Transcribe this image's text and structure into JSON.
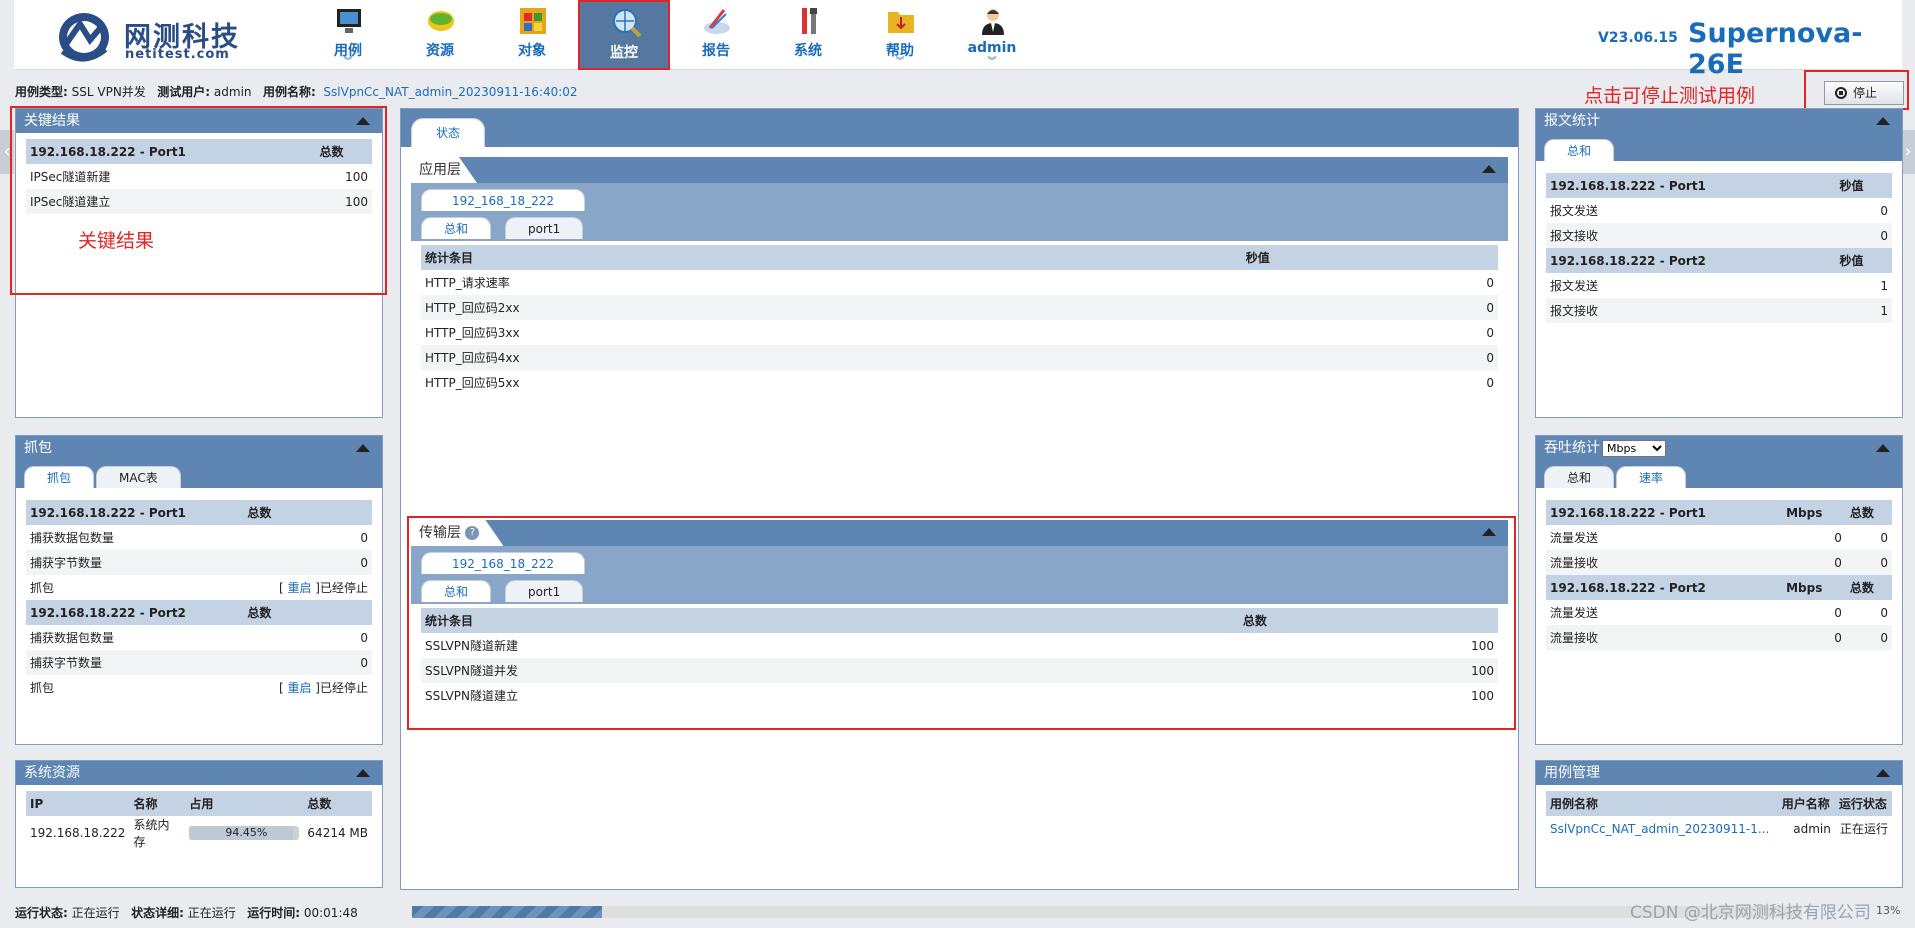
{
  "header": {
    "logo_name": "网测科技",
    "logo_sub": "netitest.com",
    "nav": [
      {
        "label": "用例",
        "caret": true,
        "icon": "monitor-icon"
      },
      {
        "label": "资源",
        "caret": false,
        "icon": "resource-icon"
      },
      {
        "label": "对象",
        "caret": false,
        "icon": "objects-icon"
      },
      {
        "label": "监控",
        "caret": false,
        "icon": "globe-search-icon"
      },
      {
        "label": "报告",
        "caret": false,
        "icon": "report-icon"
      },
      {
        "label": "系统",
        "caret": false,
        "icon": "tools-icon"
      },
      {
        "label": "帮助",
        "caret": true,
        "icon": "folder-icon"
      },
      {
        "label": "admin",
        "caret": true,
        "icon": "user-icon"
      }
    ],
    "version": "V23.06.15",
    "product": "Supernova-26E"
  },
  "info": {
    "type_label": "用例类型:",
    "type_value": "SSL VPN并发",
    "user_label": "测试用户:",
    "user_value": "admin",
    "name_label": "用例名称:",
    "name_value": "SslVpnCc_NAT_admin_20230911-16:40:02"
  },
  "hint": "点击可停止测试用例",
  "stop_label": "停止",
  "key_results": {
    "title": "关键结果",
    "header": [
      "192.168.18.222 - Port1",
      "总数"
    ],
    "rows": [
      [
        "IPSec隧道新建",
        "100"
      ],
      [
        "IPSec隧道建立",
        "100"
      ]
    ],
    "note": "关键结果"
  },
  "capture": {
    "title": "抓包",
    "tabs": [
      "抓包",
      "MAC表"
    ],
    "groups": [
      {
        "header": [
          "192.168.18.222 - Port1",
          "总数"
        ],
        "rows": [
          [
            "捕获数据包数量",
            "0"
          ],
          [
            "捕获字节数量",
            "0"
          ]
        ],
        "capture_label": "抓包",
        "restart": "重启",
        "stopped": "已经停止"
      },
      {
        "header": [
          "192.168.18.222 - Port2",
          "总数"
        ],
        "rows": [
          [
            "捕获数据包数量",
            "0"
          ],
          [
            "捕获字节数量",
            "0"
          ]
        ],
        "capture_label": "抓包",
        "restart": "重启",
        "stopped": "已经停止"
      }
    ]
  },
  "sysres": {
    "title": "系统资源",
    "headers": [
      "IP",
      "名称",
      "占用",
      "总数"
    ],
    "row": {
      "ip": "192.168.18.222",
      "name": "系统内存",
      "bar_label": "94.45%",
      "bar_fraction": 0.9445,
      "total": "64214 MB"
    }
  },
  "center": {
    "status_tab": "状态",
    "app_layer": {
      "title": "应用层",
      "ip_tab": "192_168_18_222",
      "tabs": [
        "总和",
        "port1"
      ],
      "headers": [
        "统计条目",
        "秒值"
      ],
      "rows": [
        [
          "HTTP_请求速率",
          "0"
        ],
        [
          "HTTP_回应码2xx",
          "0"
        ],
        [
          "HTTP_回应码3xx",
          "0"
        ],
        [
          "HTTP_回应码4xx",
          "0"
        ],
        [
          "HTTP_回应码5xx",
          "0"
        ]
      ]
    },
    "transport_layer": {
      "title": "传输层",
      "ip_tab": "192_168_18_222",
      "tabs": [
        "总和",
        "port1"
      ],
      "headers": [
        "统计条目",
        "总数"
      ],
      "rows": [
        [
          "SSLVPN隧道新建",
          "100"
        ],
        [
          "SSLVPN隧道并发",
          "100"
        ],
        [
          "SSLVPN隧道建立",
          "100"
        ]
      ]
    }
  },
  "packet_stats": {
    "title": "报文统计",
    "tab": "总和",
    "groups": [
      {
        "header": [
          "192.168.18.222 - Port1",
          "秒值"
        ],
        "rows": [
          [
            "报文发送",
            "0"
          ],
          [
            "报文接收",
            "0"
          ]
        ]
      },
      {
        "header": [
          "192.168.18.222 - Port2",
          "秒值"
        ],
        "rows": [
          [
            "报文发送",
            "1"
          ],
          [
            "报文接收",
            "1"
          ]
        ]
      }
    ]
  },
  "throughput": {
    "title": "吞吐统计",
    "unit": "Mbps",
    "tabs": [
      "总和",
      "速率"
    ],
    "groups": [
      {
        "header": [
          "192.168.18.222 - Port1",
          "Mbps",
          "总数"
        ],
        "rows": [
          [
            "流量发送",
            "0",
            "0"
          ],
          [
            "流量接收",
            "0",
            "0"
          ]
        ]
      },
      {
        "header": [
          "192.168.18.222 - Port2",
          "Mbps",
          "总数"
        ],
        "rows": [
          [
            "流量发送",
            "0",
            "0"
          ],
          [
            "流量接收",
            "0",
            "0"
          ]
        ]
      }
    ]
  },
  "case_mgmt": {
    "title": "用例管理",
    "headers": [
      "用例名称",
      "用户名称",
      "运行状态"
    ],
    "row": [
      "SslVpnCc_NAT_admin_20230911-1...",
      "admin",
      "正在运行"
    ]
  },
  "status_bar": {
    "run_label": "运行状态:",
    "run_value": "正在运行",
    "detail_label": "状态详细:",
    "detail_value": "正在运行",
    "time_label": "运行时间:",
    "time_value": "00:01:48",
    "progress_fraction": 0.137,
    "percent": "13%"
  },
  "watermark": "CSDN @北京网测科技有限公司",
  "colors": {
    "accent": "#1a6cbb",
    "panel_header": "#5f86b2",
    "highlight": "#e32424"
  }
}
